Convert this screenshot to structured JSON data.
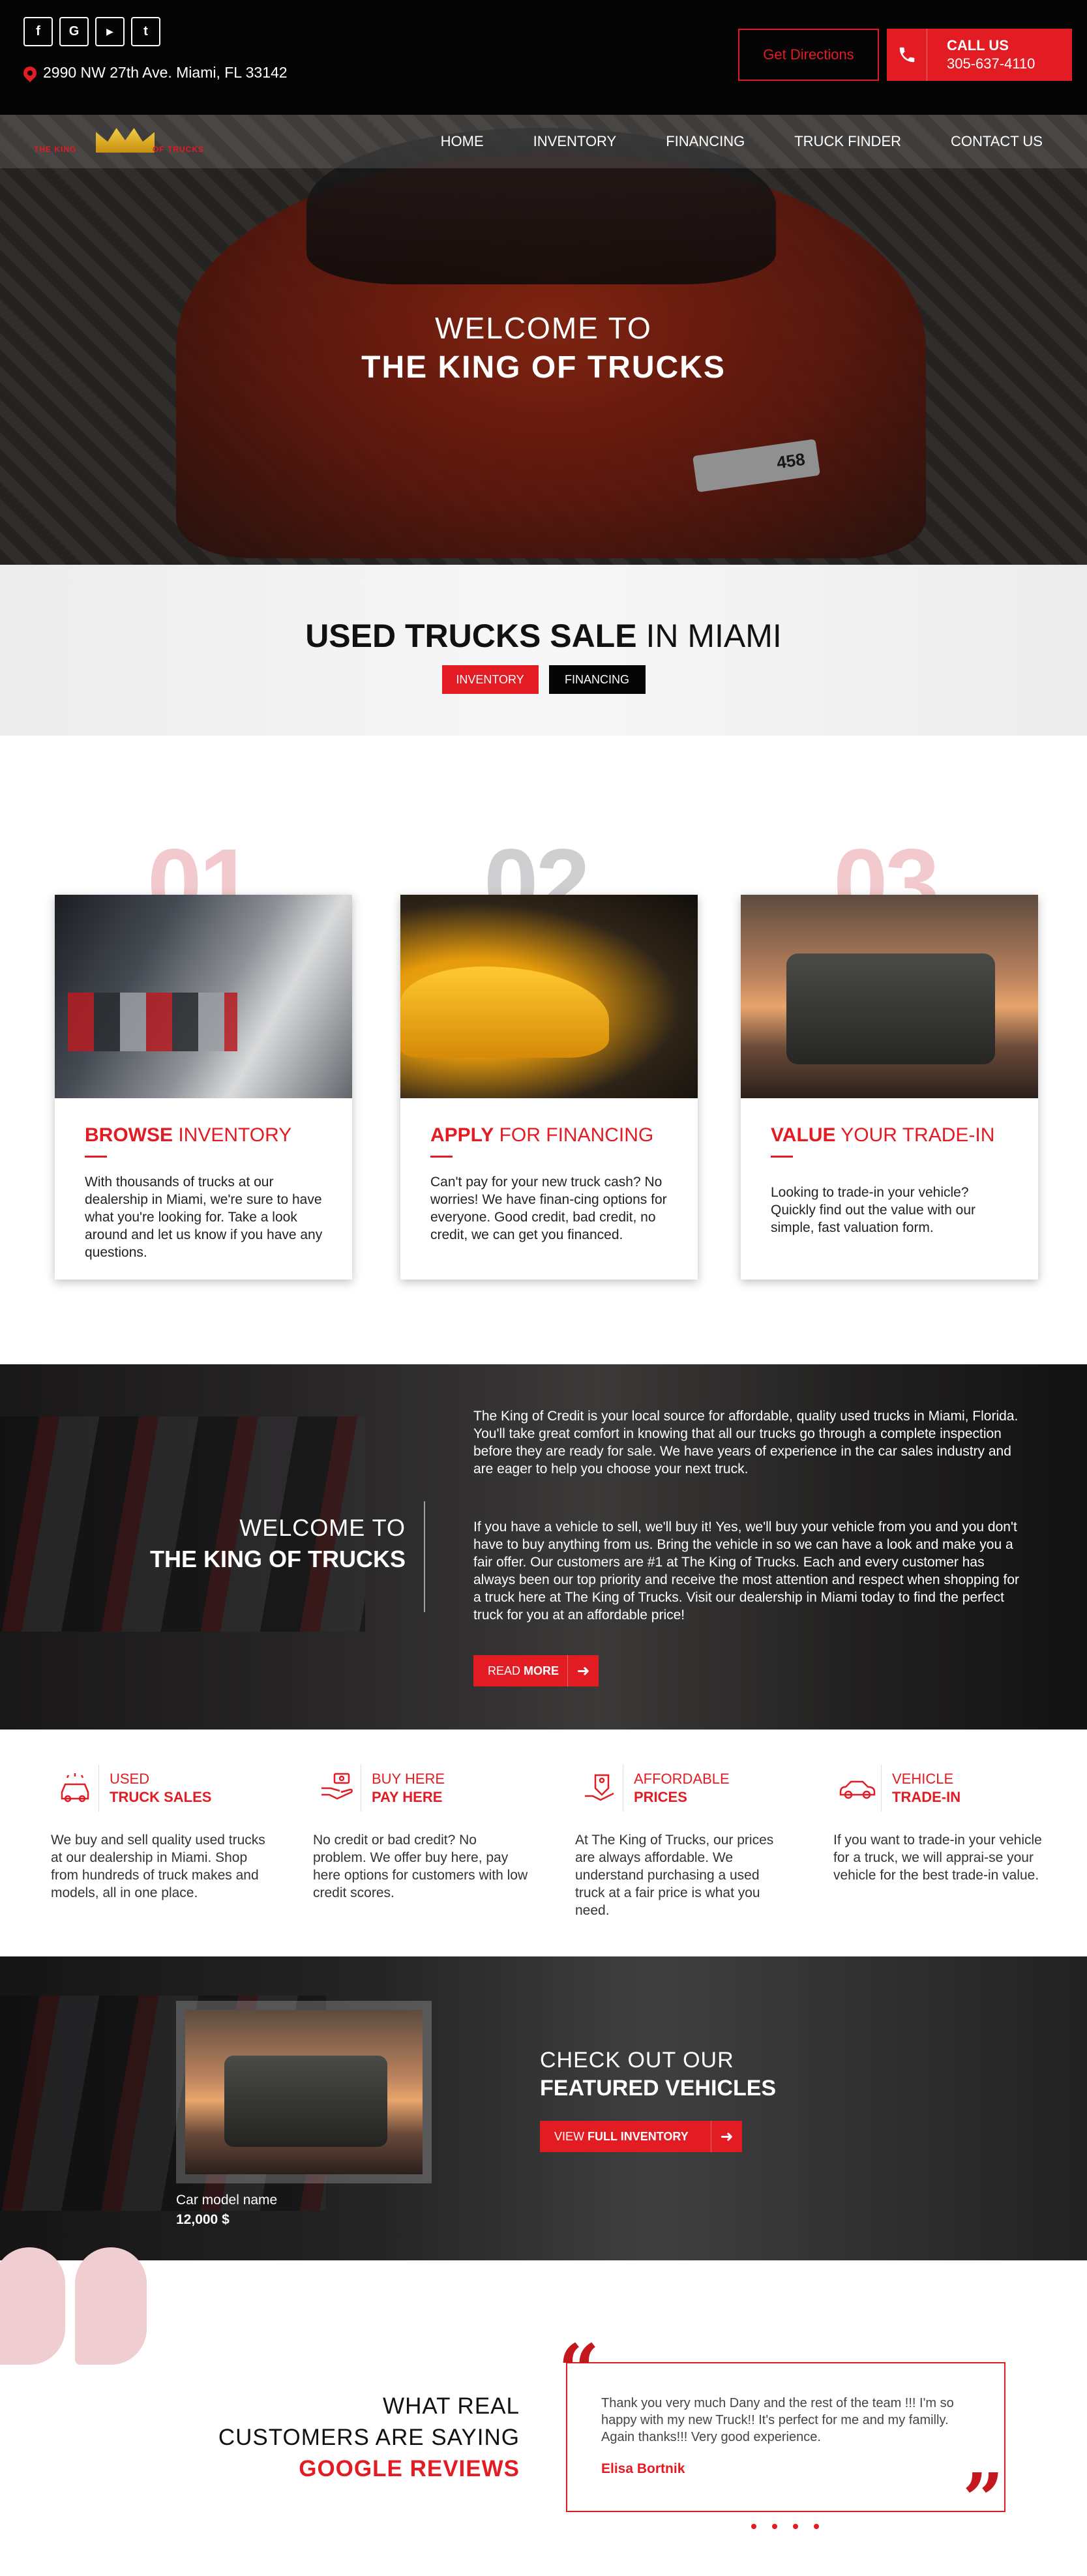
{
  "topbar": {
    "social": [
      {
        "name": "facebook-icon",
        "glyph": "f"
      },
      {
        "name": "google-icon",
        "glyph": "G"
      },
      {
        "name": "youtube-icon",
        "glyph": "▶"
      },
      {
        "name": "twitter-icon",
        "glyph": "t"
      }
    ],
    "address": "2990 NW 27th Ave. Miami, FL 33142",
    "directions_label": "Get Directions",
    "call_label": "CALL US",
    "phone": "305-637-4110"
  },
  "nav": {
    "logo_left": "THE KING",
    "logo_right": "OF TRUCKS",
    "items": [
      "HOME",
      "INVENTORY",
      "FINANCING",
      "TRUCK FINDER",
      "CONTACT US"
    ]
  },
  "hero": {
    "line1": "WELCOME TO",
    "line2": "THE KING OF TRUCKS",
    "plate": "458"
  },
  "used": {
    "title_bold": "USED TRUCKS SALE",
    "title_rest": " IN MIAMI",
    "btn_inventory": "INVENTORY",
    "btn_financing": "FINANCING"
  },
  "steps": [
    {
      "num": "01",
      "title_bold": "BROWSE",
      "title_rest": " INVENTORY",
      "text": "With thousands of trucks at our dealership in Miami, we're sure to have what you're looking for. Take a look around and let us know if you have any questions."
    },
    {
      "num": "02",
      "title_bold": "APPLY",
      "title_rest": " FOR FINANCING",
      "text": "Can't pay for your new truck cash? No worries! We have finan-cing options for everyone. Good credit, bad credit, no credit, we can get you financed."
    },
    {
      "num": "03",
      "title_bold": "VALUE",
      "title_rest": " YOUR TRADE-IN",
      "text": "Looking to trade-in your vehicle? Quickly find out the value with our simple, fast valuation form."
    }
  ],
  "welcome": {
    "line1": "WELCOME TO",
    "line2": "THE KING OF TRUCKS",
    "para1": "The King of Credit is your local source for affordable, quality used trucks in Miami, Florida. You'll take great comfort in knowing that all our trucks go through a complete inspection before they are ready for sale. We have years of experience in the car sales industry and are eager to help you choose your next truck.",
    "para2": "If you have a vehicle to sell, we'll buy it! Yes, we'll buy your vehicle from you and you don't have to buy anything from us. Bring the vehicle in so we can have a look and make you a fair offer. Our customers are #1 at The King of Trucks. Each and every customer has always been our top priority and receive the most attention and respect when shopping for a truck here at The King of Trucks. Visit our dealership in Miami today to find the perfect truck for you at an affordable price!",
    "btn_light": "READ",
    "btn_bold": "MORE"
  },
  "services": [
    {
      "icon": "car-wash-icon",
      "top": "USED",
      "bottom": "TRUCK SALES",
      "text": "We buy and sell quality used trucks at our dealership in Miami. Shop from hundreds of truck makes and models, all in one place."
    },
    {
      "icon": "hand-money-icon",
      "top": "BUY HERE",
      "bottom": "PAY HERE",
      "text": "No credit or bad credit? No problem. We offer buy here, pay here options for customers with low credit scores."
    },
    {
      "icon": "price-tag-hand-icon",
      "top": "AFFORDABLE",
      "bottom": "PRICES",
      "text": "At The King of Trucks, our prices are always affordable. We understand purchasing a used truck at a fair price is what you need."
    },
    {
      "icon": "car-outline-icon",
      "top": "VEHICLE",
      "bottom": "TRADE-IN",
      "text": "If you want to trade-in your vehicle for a truck, we will apprai-se your vehicle for the best trade-in value."
    }
  ],
  "featured": {
    "car_model": "Car model name",
    "price": "12,000 $",
    "line1": "CHECK OUT OUR",
    "line2": "FEATURED VEHICLES",
    "btn_light": "VIEW",
    "btn_bold": "FULL INVENTORY"
  },
  "reviews": {
    "line1": "WHAT REAL",
    "line2": "CUSTOMERS ARE SAYING",
    "line3": "GOOGLE REVIEWS",
    "quote": "Thank you very much Dany and the rest of the team !!! I'm so happy with my new Truck!! It's perfect for me and my familly. Again thanks!!! Very good experience.",
    "author": "Elisa Bortnik"
  },
  "colors": {
    "accent": "#e31b23",
    "dark": "#050505"
  }
}
